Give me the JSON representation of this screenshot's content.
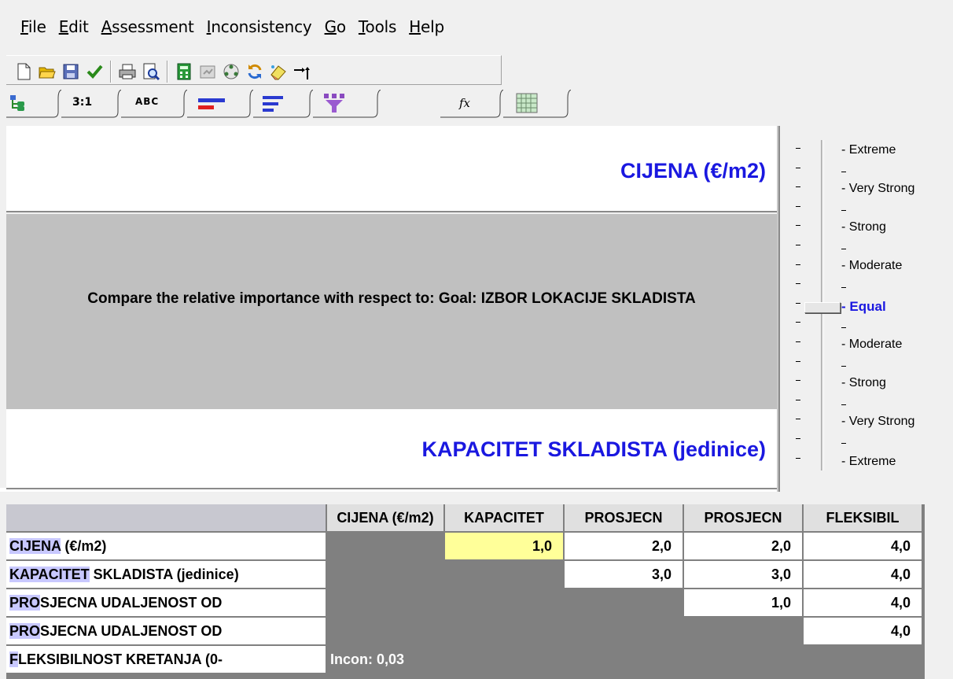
{
  "menu": {
    "items": [
      {
        "underline": "F",
        "rest": "ile"
      },
      {
        "underline": "E",
        "rest": "dit"
      },
      {
        "underline": "A",
        "rest": "ssessment"
      },
      {
        "underline": "I",
        "rest": "nconsistency"
      },
      {
        "underline": "G",
        "rest": "o"
      },
      {
        "underline": "T",
        "rest": "ools"
      },
      {
        "underline": "H",
        "rest": "elp"
      }
    ]
  },
  "toolbar": {
    "buttons": [
      "new-file-icon",
      "open-folder-icon",
      "save-icon",
      "check-icon",
      "print-icon",
      "print-preview-icon",
      "calculator-icon",
      "report-icon",
      "network-icon",
      "refresh-icon",
      "eraser-icon",
      "arrows-icon"
    ]
  },
  "tabs": {
    "items": [
      {
        "name": "tree-icon",
        "label": ""
      },
      {
        "name": "numerical",
        "label": "3:1"
      },
      {
        "name": "verbal",
        "label": "ABC"
      },
      {
        "name": "graphical-icon",
        "label": ""
      },
      {
        "name": "bars-icon",
        "label": ""
      },
      {
        "name": "funnel-icon",
        "label": ""
      },
      {
        "name": "formula",
        "label": "fx"
      },
      {
        "name": "matrix-icon",
        "label": ""
      }
    ]
  },
  "comparison": {
    "top_item": "CIJENA (€/m2)",
    "question": "Compare the relative importance with respect to: Goal: IZBOR LOKACIJE SKLADISTA",
    "bottom_item": "KAPACITET SKLADISTA (jedinice)"
  },
  "scale": {
    "labels": [
      "Extreme",
      "Very Strong",
      "Strong",
      "Moderate",
      "Equal",
      "Moderate",
      "Strong",
      "Very Strong",
      "Extreme"
    ],
    "selected": "Equal"
  },
  "matrix": {
    "columns": [
      "CIJENA (€/m2)",
      "KAPACITET",
      "PROSJECN",
      "PROSJECN",
      "FLEKSIBIL"
    ],
    "rows": [
      {
        "hl": "CIJENA",
        "rest": " (€/m2)",
        "cells": [
          "",
          "1,0",
          "2,0",
          "2,0",
          "4,0"
        ]
      },
      {
        "hl": "KAPACITET",
        "rest": " SKLADISTA (jedinice)",
        "cells": [
          "",
          "",
          "3,0",
          "3,0",
          "4,0"
        ]
      },
      {
        "hl": "PRO",
        "rest": "SJECNA UDALJENOST OD",
        "cells": [
          "",
          "",
          "",
          "1,0",
          "4,0"
        ]
      },
      {
        "hl": "PRO",
        "rest": "SJECNA UDALJENOST OD",
        "cells": [
          "",
          "",
          "",
          "",
          "4,0"
        ]
      },
      {
        "hl": "F",
        "rest": "LEKSIBILNOST KRETANJA (0-",
        "cells": [
          "Incon: 0,03",
          "",
          "",
          "",
          ""
        ]
      }
    ]
  },
  "colors": {
    "accent_text": "#1a18e0",
    "selected_cell": "#ffff99",
    "row_highlight": "#c8c8ff"
  }
}
